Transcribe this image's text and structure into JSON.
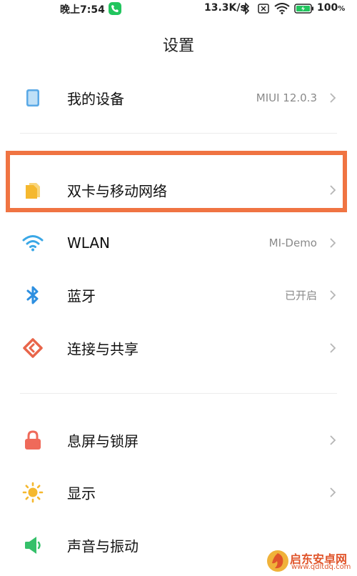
{
  "status_bar": {
    "time": "晚上7:54",
    "network_speed": "13.3K/s",
    "battery_percent": "100",
    "battery_unit": "%",
    "icons": [
      "call-icon",
      "bluetooth-icon",
      "no-sim-icon",
      "wifi-icon",
      "battery-charging-icon"
    ]
  },
  "page": {
    "title": "设置"
  },
  "sections": [
    {
      "items": [
        {
          "label": "我的设备",
          "value": "MIUI 12.0.3",
          "icon": "device-icon"
        }
      ]
    },
    {
      "items": [
        {
          "label": "双卡与移动网络",
          "value": "",
          "icon": "sim-card-icon",
          "highlighted": true
        },
        {
          "label": "WLAN",
          "value": "MI-Demo",
          "icon": "wifi-icon"
        },
        {
          "label": "蓝牙",
          "value": "已开启",
          "icon": "bluetooth-icon"
        },
        {
          "label": "连接与共享",
          "value": "",
          "icon": "share-icon"
        }
      ]
    },
    {
      "items": [
        {
          "label": "息屏与锁屏",
          "value": "",
          "icon": "lock-icon"
        },
        {
          "label": "显示",
          "value": "",
          "icon": "brightness-icon"
        },
        {
          "label": "声音与振动",
          "value": "",
          "icon": "speaker-icon"
        }
      ]
    }
  ],
  "watermark": {
    "name": "启东安卓网",
    "url": "www.qdltdq.com"
  },
  "colors": {
    "highlight_border": "#f07442",
    "device_icon": "#5aa9e6",
    "sim_icon": "#f5b82e",
    "wifi_icon": "#3aa7e6",
    "bluetooth_icon": "#2d8fe0",
    "share_icon": "#e8654a",
    "lock_icon": "#ef6a5a",
    "brightness_icon": "#f5b82e",
    "speaker_icon": "#35c06a",
    "call_badge": "#22c55e",
    "battery_green": "#22c55e"
  }
}
